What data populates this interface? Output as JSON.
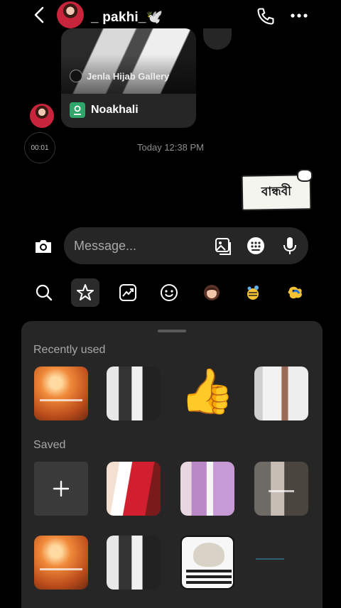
{
  "header": {
    "username": "_ pakhi_🕊️",
    "icons": {
      "back": "chevron-left-icon",
      "call": "phone-icon",
      "more": "more-dots-icon"
    }
  },
  "shared_post": {
    "source": "Jenla Hijab Gallery",
    "location": "Noakhali"
  },
  "timer_label": "00:01",
  "timestamp": "Today 12:38 PM",
  "sent_sticker_text": "বান্ধবী",
  "composer": {
    "placeholder": "Message...",
    "icons": [
      "camera-icon",
      "gallery-icon",
      "sticker-icon",
      "microphone-icon"
    ]
  },
  "tools": [
    "search-icon",
    "star-icon",
    "trending-icon",
    "emoji-icon",
    "avatar-icon",
    "bee-sticker-icon",
    "bird-sticker-icon"
  ],
  "panel": {
    "recently_used_label": "Recently used",
    "saved_label": "Saved",
    "add_label": "+",
    "thumbs_emoji": "👍"
  }
}
